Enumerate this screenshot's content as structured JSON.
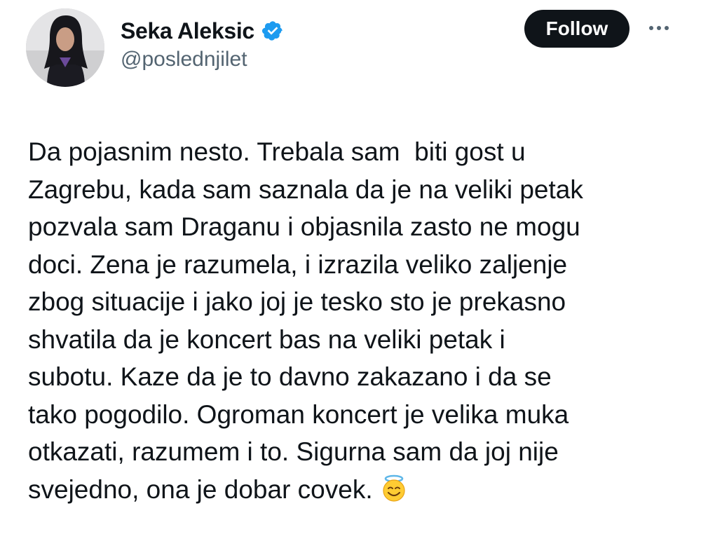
{
  "user": {
    "display_name": "Seka Aleksic",
    "handle": "@poslednjilet",
    "verified": true,
    "avatar_icon": "profile-photo"
  },
  "actions": {
    "follow_label": "Follow",
    "more_icon": "more-dots-icon"
  },
  "tweet": {
    "lines": [
      "Da pojasnim nesto. Trebala sam  biti gost u",
      "Zagrebu, kada sam saznala da je na veliki petak",
      "pozvala sam Draganu i objasnila zasto ne mogu",
      "doci. Zena je razumela, i izrazila veliko zaljenje",
      "zbog situacije i jako joj je tesko sto je prekasno",
      "shvatila da je koncert bas na veliki petak i",
      "subotu. Kaze da je to davno zakazano i da se",
      "tako pogodilo. Ogroman koncert je velika muka",
      "otkazati, razumem i to. Sigurna sam da joj nije",
      "svejedno, ona je dobar covek."
    ],
    "emoji": "smiling-face-with-halo"
  },
  "colors": {
    "text": "#0f1419",
    "secondary": "#536471",
    "verified_blue": "#1d9bf0",
    "follow_bg": "#0f1419"
  }
}
